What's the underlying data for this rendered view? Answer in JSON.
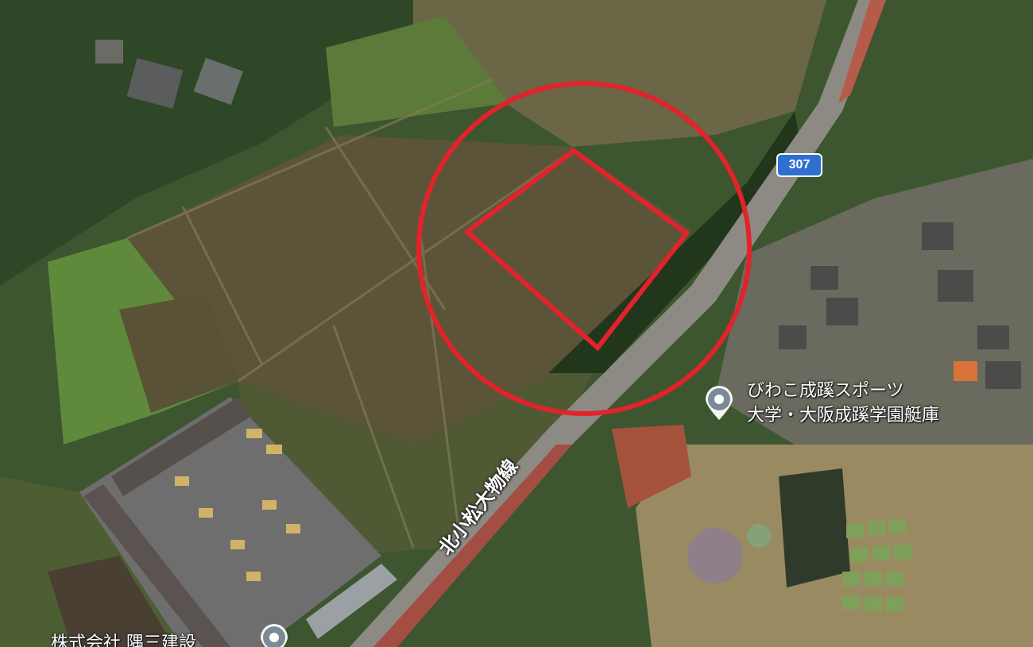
{
  "map": {
    "type": "satellite",
    "annotation": {
      "shape": "circle-with-quadrilateral",
      "color": "#e3222b"
    }
  },
  "road": {
    "name": "北小松大物線",
    "route_number": "307"
  },
  "pois": [
    {
      "lines": [
        "びわこ成蹊スポーツ",
        "大学・大阪成蹊学園艇庫"
      ],
      "icon": "location-pin-icon"
    },
    {
      "lines": [
        "株式会社 隅三建設"
      ],
      "icon": "location-pin-icon"
    }
  ],
  "colors": {
    "route_shield": "#2f6fd0",
    "annotation": "#e3222b",
    "field": "#5d5a3a",
    "vegetation": "#2f4a24"
  }
}
